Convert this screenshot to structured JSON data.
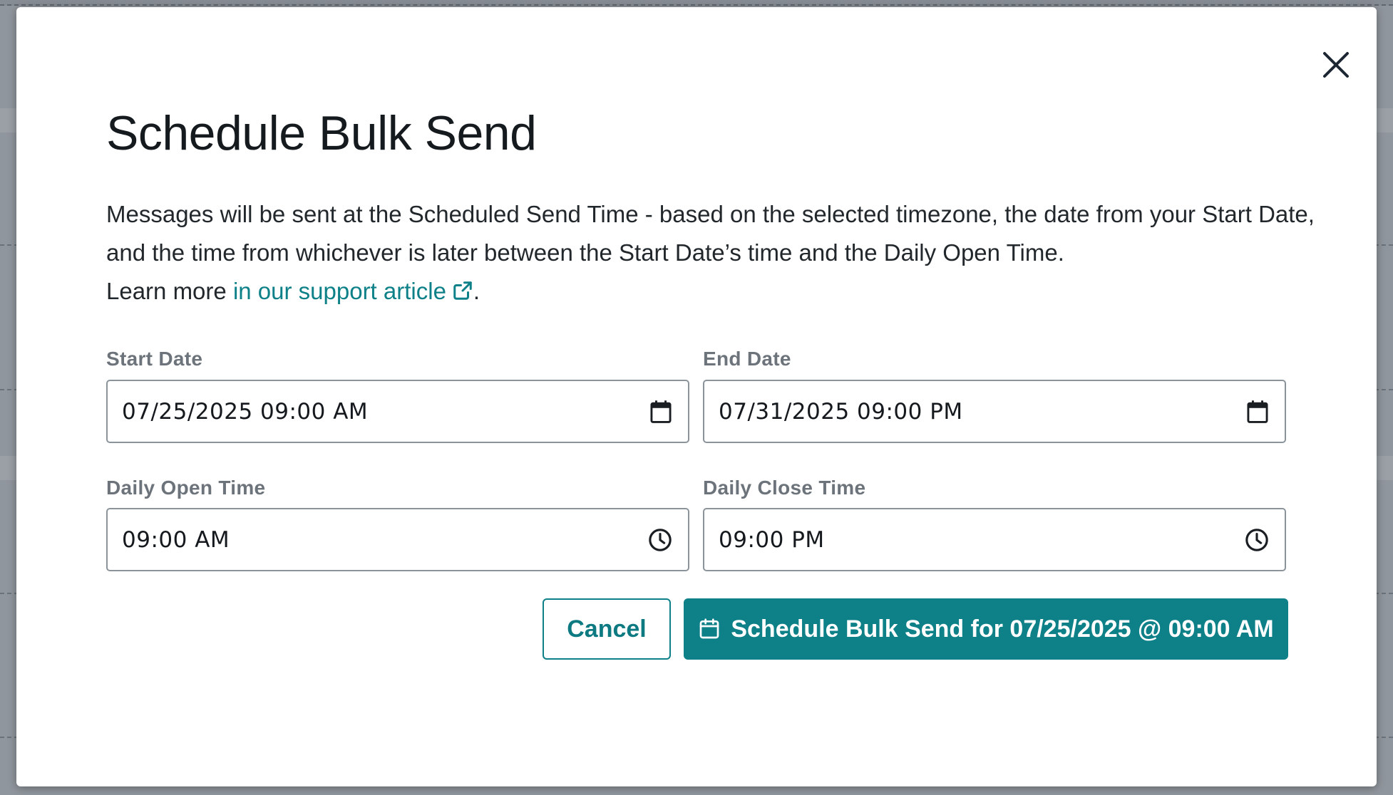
{
  "modal": {
    "title": "Schedule Bulk Send",
    "description_text": "Messages will be sent at the Scheduled Send Time - based on the selected timezone, the date from your Start Date, and the time from whichever is later between the Start Date’s time and the Daily Open Time.",
    "learn_more_prefix": "Learn more ",
    "support_link_text": "in our support article",
    "learn_more_suffix": "."
  },
  "fields": {
    "start_date": {
      "label": "Start Date",
      "value": "07/25/2025 09:00 AM",
      "icon": "calendar-icon"
    },
    "end_date": {
      "label": "End Date",
      "value": "07/31/2025 09:00 PM",
      "icon": "calendar-icon"
    },
    "daily_open_time": {
      "label": "Daily Open Time",
      "value": "09:00 AM",
      "icon": "clock-icon"
    },
    "daily_close_time": {
      "label": "Daily Close Time",
      "value": "09:00 PM",
      "icon": "clock-icon"
    }
  },
  "actions": {
    "cancel_label": "Cancel",
    "schedule_label": "Schedule Bulk Send for 07/25/2025 @ 09:00 AM"
  },
  "colors": {
    "accent": "#0d8088",
    "text": "#22272c",
    "label": "#6c737a",
    "overlay": "#90969d"
  }
}
